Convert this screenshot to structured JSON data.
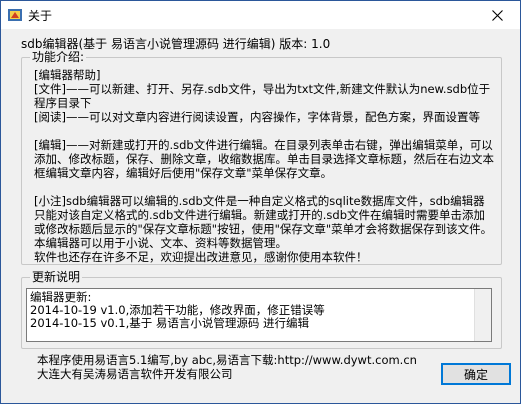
{
  "window": {
    "title": "关于"
  },
  "heading": "sdb编辑器(基于 易语言小说管理源码 进行编辑) 版本: 1.0",
  "intro": {
    "legend": "功能介绍:",
    "paragraphs": [
      "        [编辑器帮助]",
      "        [文件]——可以新建、打开、另存.sdb文件，导出为txt文件,新建文件默认为new.sdb位于程序目录下",
      "        [阅读]——可以对文章内容进行阅读设置，内容操作，字体背景，配色方案，界面设置等",
      "",
      "        [编辑]——对新建或打开的.sdb文件进行编辑。在目录列表单击右键，弹出编辑菜单，可以添加、修改标题，保存、删除文章，收缩数据库。单击目录选择文章标题，然后在右边文本框编辑文章内容，编辑好后使用\"保存文章\"菜单保存文章。",
      "",
      "        [小注]sdb编辑器可以编辑的.sdb文件是一种自定义格式的sqlite数据库文件，sdb编辑器只能对该自定义格式的.sdb文件进行编辑。新建或打开的.sdb文件在编辑时需要单击添加或修改标题后显示的\"保存文章标题\"按钮，使用\"保存文章\"菜单才会将数据保存到该文件。",
      "        本编辑器可以用于小说、文本、资料等数据管理。",
      "        软件也还存在许多不足，欢迎提出改进意见，感谢你使用本软件！"
    ]
  },
  "changelog": {
    "legend": "更新说明",
    "lines": [
      "编辑器更新:",
      "2014-10-19 v1.0,添加若干功能，修改界面，修正错误等",
      "2014-10-15 v0.1,基于 易语言小说管理源码 进行编辑"
    ]
  },
  "footer": {
    "line1": "本程序使用易语言5.1编写,by abc,易语言下载:http://www.dywt.com.cn",
    "line2": "大连大有吴涛易语言软件开发有限公司"
  },
  "ok_label": "确定"
}
